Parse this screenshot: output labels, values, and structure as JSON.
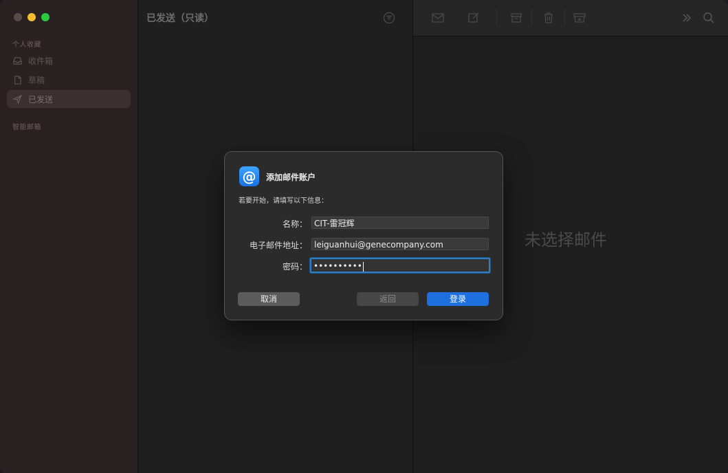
{
  "sidebar": {
    "section_favorites": "个人收藏",
    "items": [
      {
        "label": "收件箱",
        "icon": "inbox-icon"
      },
      {
        "label": "草稿",
        "icon": "document-icon"
      },
      {
        "label": "已发送",
        "icon": "paper-plane-icon"
      }
    ],
    "section_smart": "智能邮箱"
  },
  "message_list": {
    "title": "已发送（只读）"
  },
  "content": {
    "empty_text": "未选择邮件"
  },
  "dialog": {
    "title": "添加邮件账户",
    "subtitle": "若要开始，请填写以下信息：",
    "fields": {
      "name_label": "名称：",
      "name_value": "CIT-雷冠辉",
      "email_label": "电子邮件地址：",
      "email_value": "leiguanhui@genecompany.com",
      "password_label": "密码：",
      "password_value": "••••••••••"
    },
    "buttons": {
      "cancel": "取消",
      "back": "返回",
      "login": "登录"
    }
  },
  "colors": {
    "accent": "#1e6fe0",
    "focus_ring": "#2f7ec2",
    "min_button": "#f5bd2f",
    "max_button": "#2ac940"
  }
}
